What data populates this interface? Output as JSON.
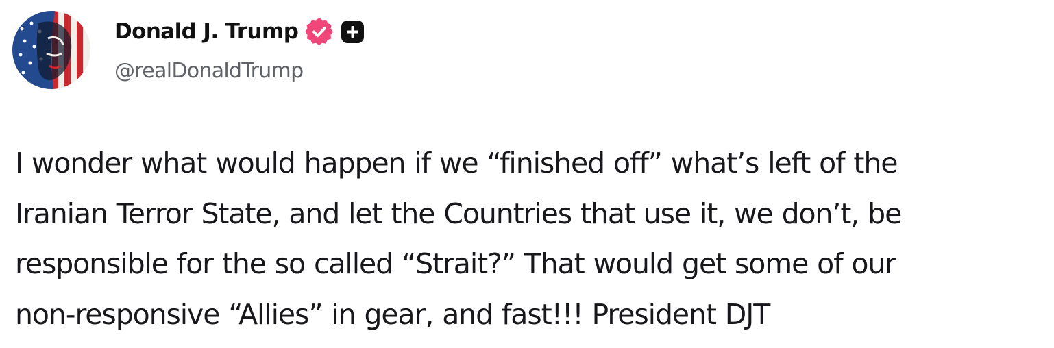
{
  "author": {
    "display_name": "Donald J. Trump",
    "handle": "@realDonaldTrump",
    "verified_icon": "verified-badge-icon",
    "verified_color": "#f0467a",
    "badge_icon": "plus-badge-icon",
    "badge_color": "#111111"
  },
  "post": {
    "lines": [
      "I wonder what would happen if we “finished off” what’s left of the",
      "Iranian Terror State, and let the Countries that use it, we don’t, be",
      "responsible for the so called “Strait?” That would get some of our",
      "non-responsive “Allies” in gear, and fast!!! President DJT"
    ]
  },
  "colors": {
    "text": "#17171c",
    "secondary_text": "#5f6368",
    "background": "#ffffff"
  }
}
